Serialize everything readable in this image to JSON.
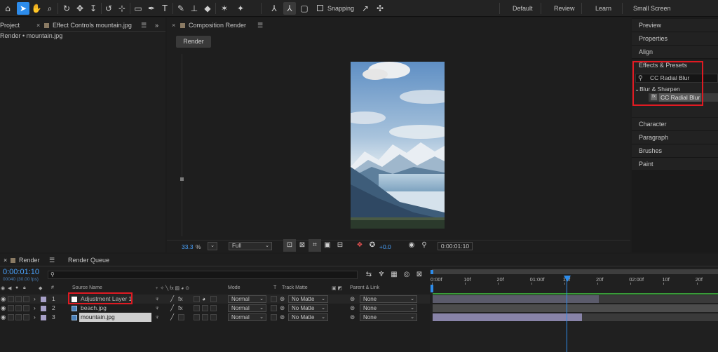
{
  "toolbar": {
    "snapping_label": "Snapping",
    "workspaces": [
      "Default",
      "Review",
      "Learn",
      "Small Screen"
    ]
  },
  "project_panel": {
    "tab": "Project",
    "effect_controls_tab": "Effect Controls mountain.jpg",
    "breadcrumb": "Render • mountain.jpg"
  },
  "composition": {
    "tab": "Composition Render",
    "render_button": "Render",
    "zoom": "33.3",
    "zoom_unit": "%",
    "resolution": "Full",
    "exposure": "+0.0",
    "timecode": "0:00:01:10"
  },
  "right_panel": {
    "items_top": [
      "Preview",
      "Properties",
      "Align"
    ],
    "effects_title": "Effects & Presets",
    "search_value": "CC Radial Blur",
    "category": "Blur & Sharpen",
    "effect": "CC Radial Blur",
    "items_bottom": [
      "Character",
      "Paragraph",
      "Brushes",
      "Paint"
    ]
  },
  "timeline": {
    "tab": "Render",
    "render_queue_tab": "Render Queue",
    "timecode": "0:00:01:10",
    "timecode_sub": "00040 (30.00 fps)",
    "headers": {
      "hash": "#",
      "source_name": "Source Name",
      "mode": "Mode",
      "t": "T",
      "track_matte": "Track Matte",
      "parent": "Parent & Link"
    },
    "ruler": [
      "0:00f",
      "10f",
      "20f",
      "01:00f",
      "10f",
      "20f",
      "02:00f",
      "10f",
      "20f"
    ],
    "layers": [
      {
        "num": "1",
        "name": "Adjustment Layer 1",
        "mode": "Normal",
        "matte": "No Matte",
        "parent": "None",
        "color": "#a7a0c8"
      },
      {
        "num": "2",
        "name": "beach.jpg",
        "mode": "Normal",
        "matte": "No Matte",
        "parent": "None",
        "color": "#a7a0c8"
      },
      {
        "num": "3",
        "name": "mountain.jpg",
        "mode": "Normal",
        "matte": "No Matte",
        "parent": "None",
        "color": "#a7a0c8"
      }
    ]
  },
  "colors": {
    "accent": "#2d8ceb",
    "highlight_box": "#e01a22",
    "timecode": "#4aa3ff"
  }
}
